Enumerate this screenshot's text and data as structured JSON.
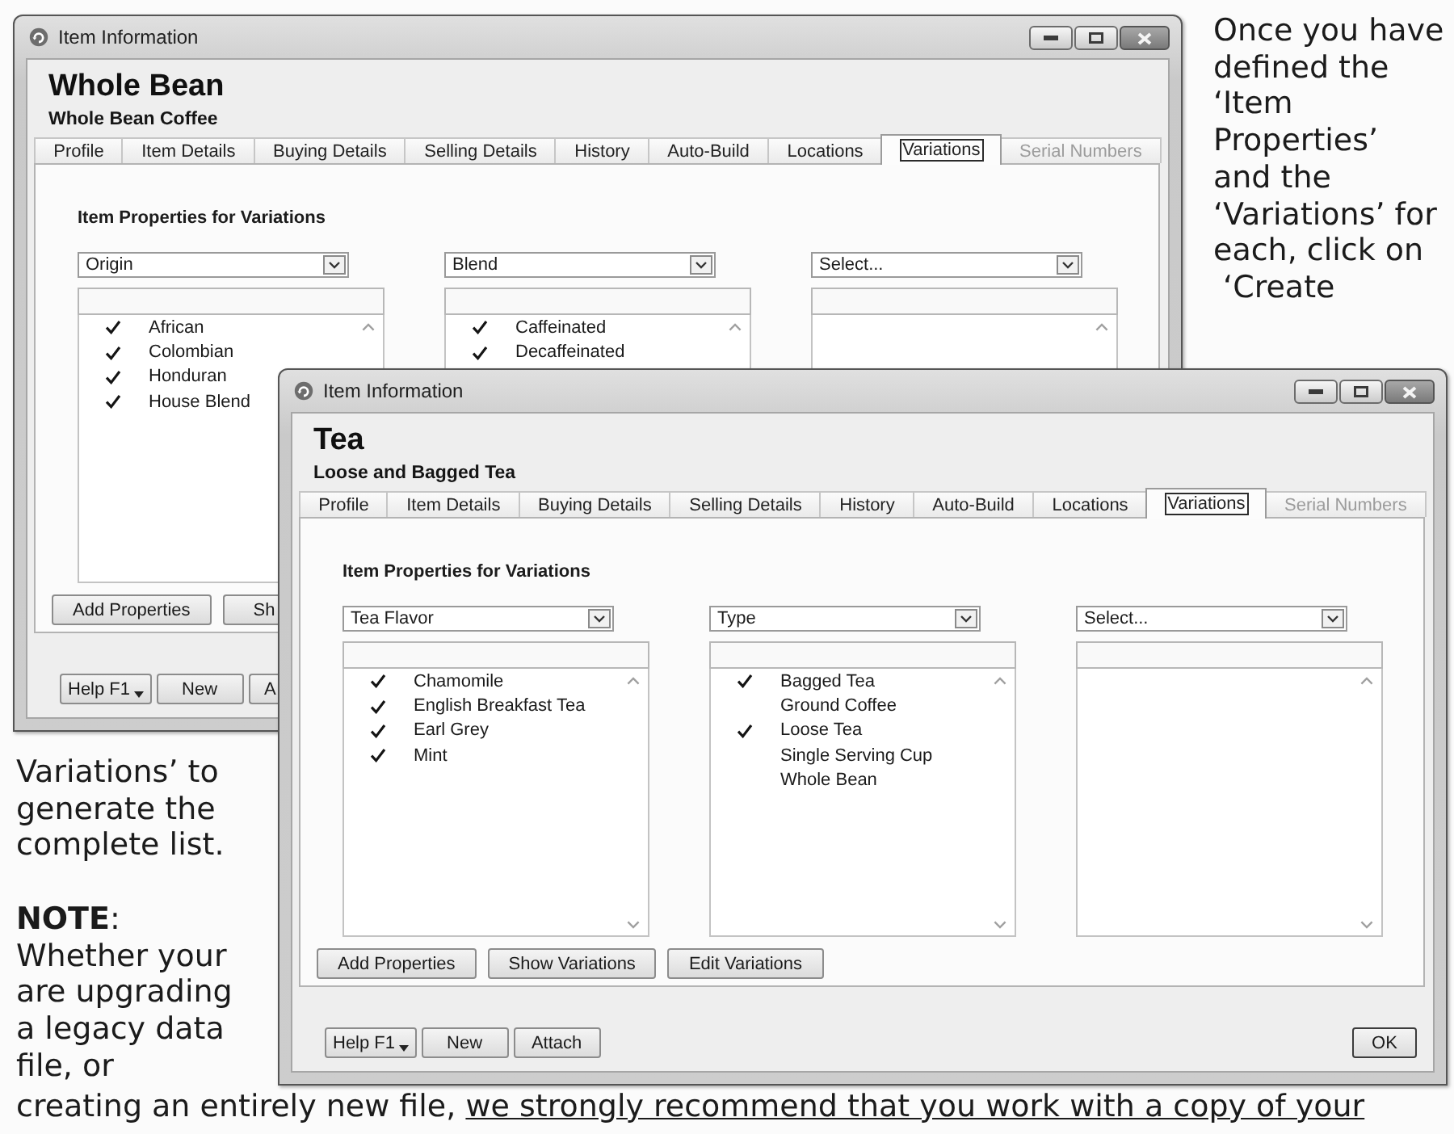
{
  "windows": [
    {
      "title": "Item Information",
      "heading": "Whole Bean",
      "subheading": "Whole Bean Coffee",
      "tabs": [
        {
          "label": "Profile",
          "selected": false,
          "disabled": false
        },
        {
          "label": "Item Details",
          "selected": false,
          "disabled": false
        },
        {
          "label": "Buying Details",
          "selected": false,
          "disabled": false
        },
        {
          "label": "Selling Details",
          "selected": false,
          "disabled": false
        },
        {
          "label": "History",
          "selected": false,
          "disabled": false
        },
        {
          "label": "Auto-Build",
          "selected": false,
          "disabled": false
        },
        {
          "label": "Locations",
          "selected": false,
          "disabled": false
        },
        {
          "label": "Variations",
          "selected": true,
          "disabled": false
        },
        {
          "label": "Serial Numbers",
          "selected": false,
          "disabled": true
        }
      ],
      "section_title": "Item Properties for Variations",
      "property_columns": [
        {
          "dropdown": "Origin",
          "items": [
            {
              "label": "African",
              "checked": true
            },
            {
              "label": "Colombian",
              "checked": true
            },
            {
              "label": "Honduran",
              "checked": true
            },
            {
              "label": "House Blend",
              "checked": true
            }
          ]
        },
        {
          "dropdown": "Blend",
          "items": [
            {
              "label": "Caffeinated",
              "checked": true
            },
            {
              "label": "Decaffeinated",
              "checked": true
            }
          ]
        },
        {
          "dropdown": "Select..."
        }
      ],
      "action_buttons": [
        {
          "label": "Add Properties",
          "cut_off": false
        },
        {
          "label": "Sh",
          "cut_off": true
        }
      ],
      "footer_buttons": [
        {
          "label": "Help F1",
          "kind": "split",
          "cut_off": false
        },
        {
          "label": "New",
          "kind": "plain",
          "cut_off": false
        },
        {
          "label": "A",
          "kind": "plain",
          "cut_off": true
        }
      ]
    },
    {
      "title": "Item Information",
      "heading": "Tea",
      "subheading": "Loose and Bagged Tea",
      "tabs": [
        {
          "label": "Profile",
          "selected": false,
          "disabled": false
        },
        {
          "label": "Item Details",
          "selected": false,
          "disabled": false
        },
        {
          "label": "Buying Details",
          "selected": false,
          "disabled": false
        },
        {
          "label": "Selling Details",
          "selected": false,
          "disabled": false
        },
        {
          "label": "History",
          "selected": false,
          "disabled": false
        },
        {
          "label": "Auto-Build",
          "selected": false,
          "disabled": false
        },
        {
          "label": "Locations",
          "selected": false,
          "disabled": false
        },
        {
          "label": "Variations",
          "selected": true,
          "disabled": false
        },
        {
          "label": "Serial Numbers",
          "selected": false,
          "disabled": true
        }
      ],
      "section_title": "Item Properties for Variations",
      "property_columns": [
        {
          "dropdown": "Tea Flavor",
          "items": [
            {
              "label": "Chamomile",
              "checked": true
            },
            {
              "label": "English Breakfast Tea",
              "checked": true
            },
            {
              "label": "Earl Grey",
              "checked": true
            },
            {
              "label": "Mint",
              "checked": true
            }
          ]
        },
        {
          "dropdown": "Type",
          "items": [
            {
              "label": "Bagged Tea",
              "checked": true
            },
            {
              "label": "Ground Coffee",
              "checked": false
            },
            {
              "label": "Loose Tea",
              "checked": true
            },
            {
              "label": "Single Serving Cup",
              "checked": false
            },
            {
              "label": "Whole Bean",
              "checked": false
            }
          ]
        },
        {
          "dropdown": "Select..."
        }
      ],
      "action_buttons": [
        {
          "label": "Add Properties",
          "cut_off": false
        },
        {
          "label": "Show Variations",
          "cut_off": false
        },
        {
          "label": "Edit Variations",
          "cut_off": false
        }
      ],
      "footer_buttons": [
        {
          "label": "Help F1",
          "kind": "split",
          "cut_off": false
        },
        {
          "label": "New",
          "kind": "plain",
          "cut_off": false
        },
        {
          "label": "Attach",
          "kind": "plain",
          "cut_off": false
        }
      ],
      "ok_button": {
        "label": "OK"
      }
    }
  ],
  "right_text": {
    "lines": [
      "Once you have",
      "defined the",
      "‘Item",
      "Properties’",
      "and the",
      "‘Variations’ for",
      "each, click on",
      " ‘Create"
    ]
  },
  "left_text": {
    "lines": [
      "Variations’ to",
      "generate the",
      "complete list."
    ]
  },
  "note": {
    "lines": [
      "**NOTE**:",
      "Whether your",
      "are upgrading",
      "a legacy data",
      "file, or"
    ]
  },
  "continuation": {
    "runs": [
      {
        "text": "creating an entirely new file, ",
        "underlined": false
      },
      {
        "text": "we strongly recommend that you work with a copy of your",
        "underlined": true
      }
    ]
  }
}
